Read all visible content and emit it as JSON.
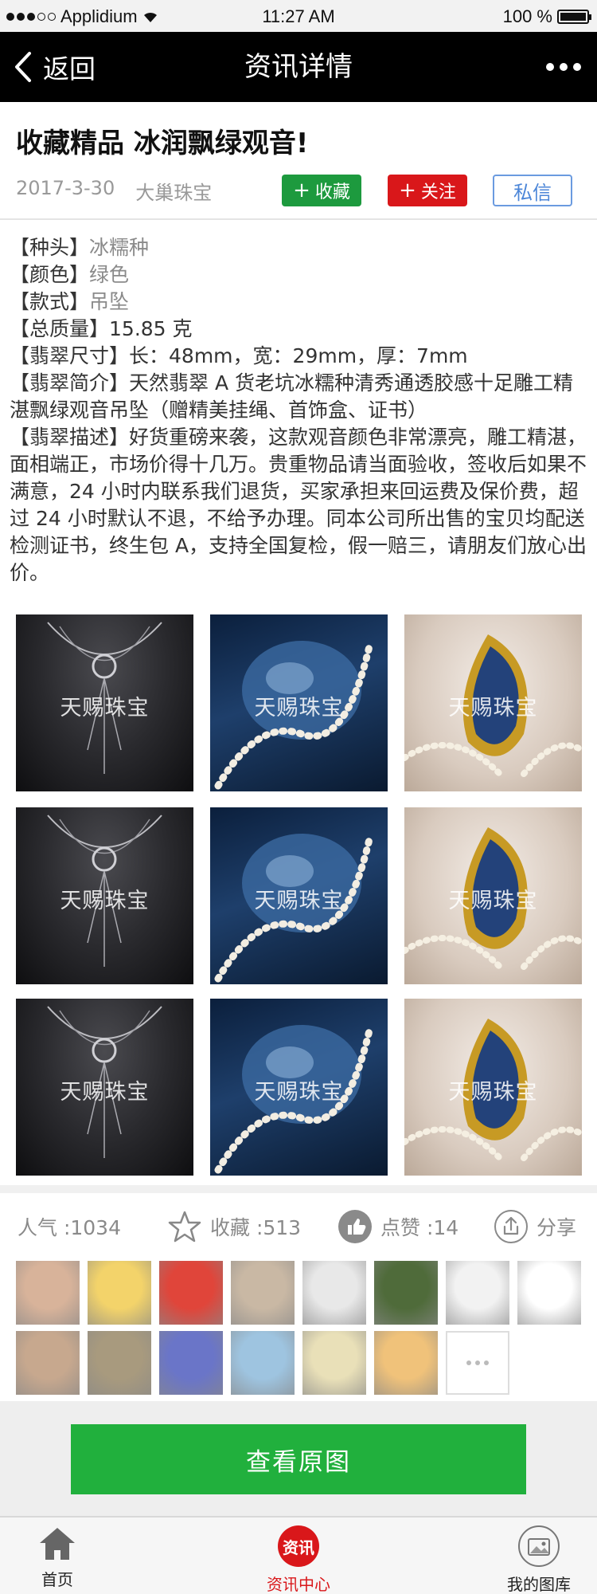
{
  "status": {
    "carrier": "Applidium",
    "time": "11:27 AM",
    "battery": "100 %",
    "battery_level": 1.0
  },
  "nav": {
    "back_label": "返回",
    "title": "资讯详情"
  },
  "article": {
    "title": "收藏精品 冰润飘绿观音!",
    "date": "2017-3-30",
    "source": "大巢珠宝",
    "fav_label": "收藏",
    "follow_label": "关注",
    "message_label": "私信"
  },
  "details": [
    {
      "key": "【种头】",
      "value": "冰糯种"
    },
    {
      "key": "【颜色】",
      "value": "绿色"
    },
    {
      "key": "【款式】",
      "value": "吊坠"
    },
    {
      "key": "【总质量】",
      "value": "15.85 克"
    },
    {
      "key": "【翡翠尺寸】",
      "value": "长：48mm，宽：29mm，厚：7mm"
    },
    {
      "key": "【翡翠简介】",
      "value": "天然翡翠 A 货老坑冰糯种清秀通透胶感十足雕工精湛飘绿观音吊坠（赠精美挂绳、首饰盒、证书）"
    },
    {
      "key": "【翡翠描述】",
      "value": "好货重磅来袭，这款观音颜色非常漂亮，雕工精湛，面相端正，市场价得十几万。贵重物品请当面验收，签收后如果不满意，24 小时内联系我们退货，买家承担来回运费及保价费，超过 24 小时默认不退，不给予办理。同本公司所出售的宝贝均配送检测证书，终生包 A，支持全国复检，假一赔三，请朋友们放心出价。"
    }
  ],
  "gallery": {
    "watermark": "天赐珠宝",
    "images": [
      "necklace",
      "stone",
      "ring",
      "necklace",
      "stone",
      "ring",
      "necklace",
      "stone",
      "ring"
    ]
  },
  "stats": {
    "popularity": "人气 :1034",
    "favorites": "收藏 :513",
    "likes": "点赞 :14",
    "share": "分享"
  },
  "avatars": [
    "#d8b39a",
    "#f3d36a",
    "#e0453a",
    "#c9b8a4",
    "#e8e8e8",
    "#4f6b3a",
    "#f2f2f2",
    "#ffffff",
    "#c7a88e",
    "#a89a7e",
    "#6a75c8",
    "#9ec4e0",
    "#e9e0b8",
    "#f0c27a"
  ],
  "view_original": "查看原图",
  "tabs": {
    "home": "首页",
    "news_badge": "资讯",
    "news": "资讯中心",
    "gallery": "我的图库"
  },
  "colors": {
    "green": "#1d9a3e",
    "red": "#d9171a",
    "blue": "#4c86d8",
    "button_green": "#21b03d"
  }
}
